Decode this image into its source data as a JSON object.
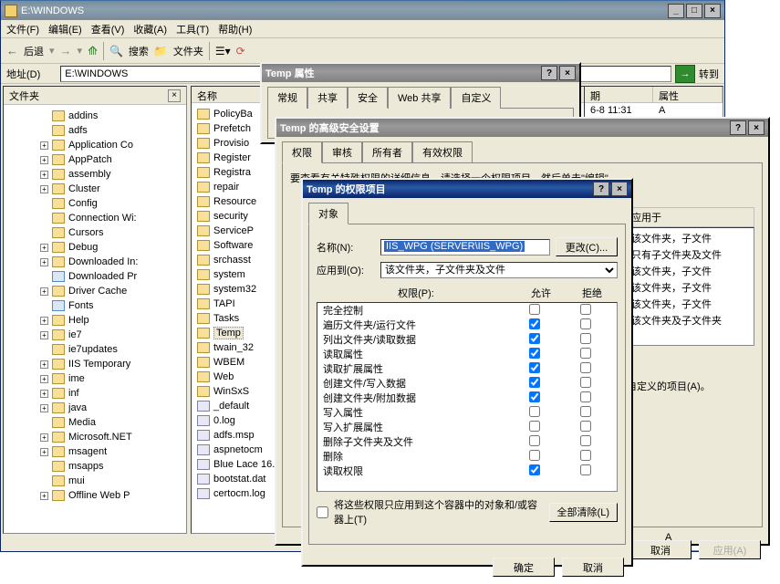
{
  "explorer": {
    "title": "E:\\WINDOWS",
    "menus": [
      "文件(F)",
      "编辑(E)",
      "查看(V)",
      "收藏(A)",
      "工具(T)",
      "帮助(H)"
    ],
    "toolbar": {
      "back": "后退",
      "search": "搜索",
      "folders": "文件夹"
    },
    "addrLabel": "地址(D)",
    "addrValue": "E:\\WINDOWS",
    "goLabel": "转到",
    "treeTitle": "文件夹",
    "tree": [
      {
        "i": 0,
        "s": "",
        "t": "addins"
      },
      {
        "i": 0,
        "s": "",
        "t": "adfs"
      },
      {
        "i": 0,
        "s": "+",
        "t": "Application Co"
      },
      {
        "i": 0,
        "s": "+",
        "t": "AppPatch"
      },
      {
        "i": 0,
        "s": "+",
        "t": "assembly"
      },
      {
        "i": 0,
        "s": "+",
        "t": "Cluster"
      },
      {
        "i": 0,
        "s": "",
        "t": "Config"
      },
      {
        "i": 0,
        "s": "",
        "t": "Connection Wi:"
      },
      {
        "i": 0,
        "s": "",
        "t": "Cursors"
      },
      {
        "i": 0,
        "s": "+",
        "t": "Debug"
      },
      {
        "i": 0,
        "s": "+",
        "t": "Downloaded In:"
      },
      {
        "i": 0,
        "s": "",
        "t": "Downloaded Pr",
        "sp": true
      },
      {
        "i": 0,
        "s": "+",
        "t": "Driver Cache"
      },
      {
        "i": 0,
        "s": "",
        "t": "Fonts",
        "sp": true
      },
      {
        "i": 0,
        "s": "+",
        "t": "Help"
      },
      {
        "i": 0,
        "s": "+",
        "t": "ie7"
      },
      {
        "i": 0,
        "s": "",
        "t": "ie7updates"
      },
      {
        "i": 0,
        "s": "+",
        "t": "IIS Temporary"
      },
      {
        "i": 0,
        "s": "+",
        "t": "ime"
      },
      {
        "i": 0,
        "s": "+",
        "t": "inf"
      },
      {
        "i": 0,
        "s": "+",
        "t": "java"
      },
      {
        "i": 0,
        "s": "",
        "t": "Media"
      },
      {
        "i": 0,
        "s": "+",
        "t": "Microsoft.NET"
      },
      {
        "i": 0,
        "s": "+",
        "t": "msagent"
      },
      {
        "i": 0,
        "s": "",
        "t": "msapps"
      },
      {
        "i": 0,
        "s": "",
        "t": "mui"
      },
      {
        "i": 0,
        "s": "+",
        "t": "Offline Web P"
      }
    ],
    "listCols": [
      "名称",
      "期",
      "属性"
    ],
    "list": [
      {
        "t": "PolicyBa",
        "k": "fld"
      },
      {
        "t": "Prefetch",
        "k": "fld"
      },
      {
        "t": "Provisio",
        "k": "fld"
      },
      {
        "t": "Register",
        "k": "fld"
      },
      {
        "t": "Registra",
        "k": "fld"
      },
      {
        "t": "repair",
        "k": "fld"
      },
      {
        "t": "Resource",
        "k": "fld"
      },
      {
        "t": "security",
        "k": "fld"
      },
      {
        "t": "ServiceP",
        "k": "fld"
      },
      {
        "t": "Software",
        "k": "fld"
      },
      {
        "t": "srchasst",
        "k": "fld"
      },
      {
        "t": "system",
        "k": "fld"
      },
      {
        "t": "system32",
        "k": "fld"
      },
      {
        "t": "TAPI",
        "k": "fld"
      },
      {
        "t": "Tasks",
        "k": "fld"
      },
      {
        "t": "Temp",
        "k": "fld",
        "sel": true
      },
      {
        "t": "twain_32",
        "k": "fld"
      },
      {
        "t": "WBEM",
        "k": "fld"
      },
      {
        "t": "Web",
        "k": "fld"
      },
      {
        "t": "WinSxS",
        "k": "fld"
      },
      {
        "t": "_default",
        "k": "fic"
      },
      {
        "t": "0.log",
        "k": "fic"
      },
      {
        "t": "adfs.msp",
        "k": "fic"
      },
      {
        "t": "aspnetocm",
        "k": "fic"
      },
      {
        "t": "Blue Lace 16.",
        "k": "fic"
      },
      {
        "t": "bootstat.dat",
        "k": "fic"
      },
      {
        "t": "certocm.log",
        "k": "fic"
      }
    ],
    "listDate": "6-8 11:31",
    "listAttr": "A",
    "listAttr2": "A"
  },
  "propDlg": {
    "title": "Temp 属性",
    "tabs": [
      "常规",
      "共享",
      "安全",
      "Web 共享",
      "自定义"
    ]
  },
  "advDlg": {
    "title": "Temp 的高级安全设置",
    "tabs": [
      "权限",
      "审核",
      "所有者",
      "有效权限"
    ],
    "hint": "要查看有关特殊权限的详细信息，请选择一个权限项目，然后单击\"编辑\"。",
    "appliesHdr": "应用于",
    "appliesList": [
      "该文件夹，子文件",
      "只有子文件夹及文件",
      "该文件夹，子文件",
      "该文件夹，子文件",
      "该文件夹，子文件",
      "该文件夹及子文件夹"
    ],
    "note": "自定义的项目(A)。",
    "ok": "确定",
    "cancel": "取消",
    "apply": "应用(A)"
  },
  "permDlg": {
    "title": "Temp 的权限项目",
    "tab": "对象",
    "nameLabel": "名称(N):",
    "nameValue": "IIS_WPG (SERVER\\IIS_WPG)",
    "changeBtn": "更改(C)...",
    "applyLabel": "应用到(O):",
    "applyValue": "该文件夹，子文件夹及文件",
    "permLabel": "权限(P):",
    "allow": "允许",
    "deny": "拒绝",
    "perms": [
      {
        "n": "完全控制",
        "a": false,
        "d": false
      },
      {
        "n": "遍历文件夹/运行文件",
        "a": true,
        "d": false
      },
      {
        "n": "列出文件夹/读取数据",
        "a": true,
        "d": false
      },
      {
        "n": "读取属性",
        "a": true,
        "d": false
      },
      {
        "n": "读取扩展属性",
        "a": true,
        "d": false
      },
      {
        "n": "创建文件/写入数据",
        "a": true,
        "d": false
      },
      {
        "n": "创建文件夹/附加数据",
        "a": true,
        "d": false
      },
      {
        "n": "写入属性",
        "a": false,
        "d": false
      },
      {
        "n": "写入扩展属性",
        "a": false,
        "d": false
      },
      {
        "n": "删除子文件夹及文件",
        "a": false,
        "d": false
      },
      {
        "n": "删除",
        "a": false,
        "d": false
      },
      {
        "n": "读取权限",
        "a": true,
        "d": false
      }
    ],
    "checkText": "将这些权限只应用到这个容器中的对象和/或容器上(T)",
    "clearBtn": "全部清除(L)",
    "ok": "确定",
    "cancel": "取消"
  }
}
